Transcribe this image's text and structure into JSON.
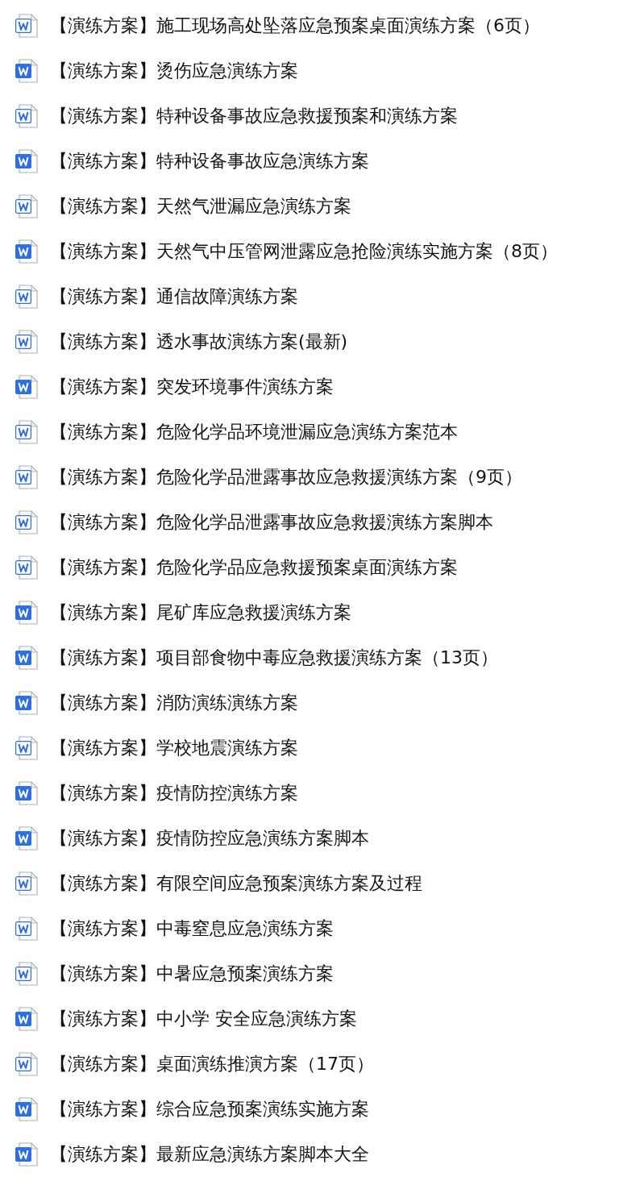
{
  "files": [
    {
      "kind": "outline",
      "name": "【演练方案】施工现场高处坠落应急预案桌面演练方案（6页）"
    },
    {
      "kind": "filled",
      "name": "【演练方案】烫伤应急演练方案"
    },
    {
      "kind": "outline",
      "name": "【演练方案】特种设备事故应急救援预案和演练方案"
    },
    {
      "kind": "filled",
      "name": "【演练方案】特种设备事故应急演练方案"
    },
    {
      "kind": "outline",
      "name": "【演练方案】天然气泄漏应急演练方案"
    },
    {
      "kind": "filled",
      "name": "【演练方案】天然气中压管网泄露应急抢险演练实施方案（8页）"
    },
    {
      "kind": "outline",
      "name": "【演练方案】通信故障演练方案"
    },
    {
      "kind": "outline",
      "name": "【演练方案】透水事故演练方案(最新)"
    },
    {
      "kind": "filled",
      "name": "【演练方案】突发环境事件演练方案"
    },
    {
      "kind": "outline",
      "name": "【演练方案】危险化学品环境泄漏应急演练方案范本"
    },
    {
      "kind": "outline",
      "name": "【演练方案】危险化学品泄露事故应急救援演练方案（9页）"
    },
    {
      "kind": "outline",
      "name": "【演练方案】危险化学品泄露事故应急救援演练方案脚本"
    },
    {
      "kind": "outline",
      "name": "【演练方案】危险化学品应急救援预案桌面演练方案"
    },
    {
      "kind": "filled",
      "name": "【演练方案】尾矿库应急救援演练方案"
    },
    {
      "kind": "filled",
      "name": "【演练方案】项目部食物中毒应急救援演练方案（13页）"
    },
    {
      "kind": "filled",
      "name": "【演练方案】消防演练演练方案"
    },
    {
      "kind": "outline",
      "name": "【演练方案】学校地震演练方案"
    },
    {
      "kind": "filled",
      "name": "【演练方案】疫情防控演练方案"
    },
    {
      "kind": "filled",
      "name": "【演练方案】疫情防控应急演练方案脚本"
    },
    {
      "kind": "outline",
      "name": "【演练方案】有限空间应急预案演练方案及过程"
    },
    {
      "kind": "outline",
      "name": "【演练方案】中毒窒息应急演练方案"
    },
    {
      "kind": "outline",
      "name": "【演练方案】中暑应急预案演练方案"
    },
    {
      "kind": "filled",
      "name": "【演练方案】中小学 安全应急演练方案"
    },
    {
      "kind": "outline",
      "name": "【演练方案】桌面演练推演方案（17页）"
    },
    {
      "kind": "filled",
      "name": "【演练方案】综合应急预案演练实施方案"
    },
    {
      "kind": "filled",
      "name": "【演练方案】最新应急演练方案脚本大全"
    }
  ]
}
